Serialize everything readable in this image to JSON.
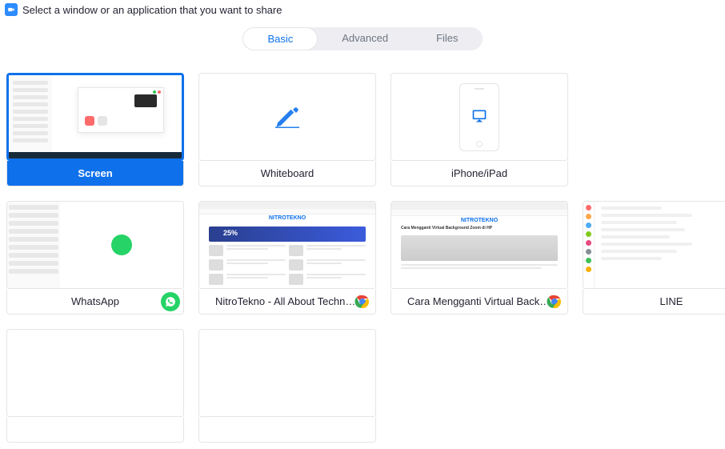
{
  "header": {
    "title": "Select a window or an application that you want to share"
  },
  "tabs": [
    {
      "id": "basic",
      "label": "Basic",
      "active": true
    },
    {
      "id": "advanced",
      "label": "Advanced",
      "active": false
    },
    {
      "id": "files",
      "label": "Files",
      "active": false
    }
  ],
  "items": [
    {
      "id": "screen",
      "label": "Screen",
      "selected": true,
      "kind": "screen"
    },
    {
      "id": "whiteboard",
      "label": "Whiteboard",
      "selected": false,
      "kind": "whiteboard"
    },
    {
      "id": "iphone",
      "label": "iPhone/iPad",
      "selected": false,
      "kind": "ios"
    },
    {
      "id": "whatsapp",
      "label": "WhatsApp",
      "selected": false,
      "kind": "app",
      "icon": "whatsapp"
    },
    {
      "id": "nitro",
      "label": "NitroTekno - All About Technolo...",
      "selected": false,
      "kind": "app",
      "icon": "chrome"
    },
    {
      "id": "cara",
      "label": "Cara Mengganti Virtual Backgrou...",
      "selected": false,
      "kind": "app",
      "icon": "chrome"
    },
    {
      "id": "line",
      "label": "LINE",
      "selected": false,
      "kind": "app",
      "icon": "line"
    },
    {
      "id": "blank1",
      "label": "",
      "selected": false,
      "kind": "blank"
    },
    {
      "id": "blank2",
      "label": "",
      "selected": false,
      "kind": "blank"
    }
  ],
  "mock_text": {
    "nitro_brand": "NITROTEKNO",
    "cara_title": "Cara Mengganti Virtual Background Zoom di HP"
  }
}
